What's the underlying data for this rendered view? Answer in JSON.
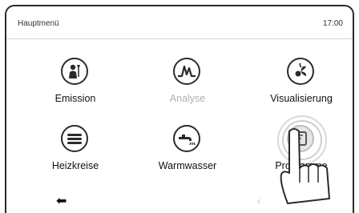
{
  "header": {
    "title": "Hauptmenü",
    "time": "17:00"
  },
  "menu": [
    {
      "label": "Emission",
      "icon": "chimney-sweep-icon",
      "enabled": true
    },
    {
      "label": "Analyse",
      "icon": "waveform-icon",
      "enabled": false
    },
    {
      "label": "Visualisierung",
      "icon": "fan-icon",
      "enabled": true
    },
    {
      "label": "Heizkreise",
      "icon": "radiator-icon",
      "enabled": true
    },
    {
      "label": "Warmwasser",
      "icon": "faucet-icon",
      "enabled": true
    },
    {
      "label": "Programme",
      "icon": "program-icon",
      "enabled": true
    }
  ],
  "nav": {
    "back_glyph": "⬅",
    "prev_glyph": "‹"
  },
  "colors": {
    "icon_stroke": "#2b2b2b",
    "disabled_text": "#b0b0b0",
    "highlight_ring": "#d9d9d9"
  }
}
